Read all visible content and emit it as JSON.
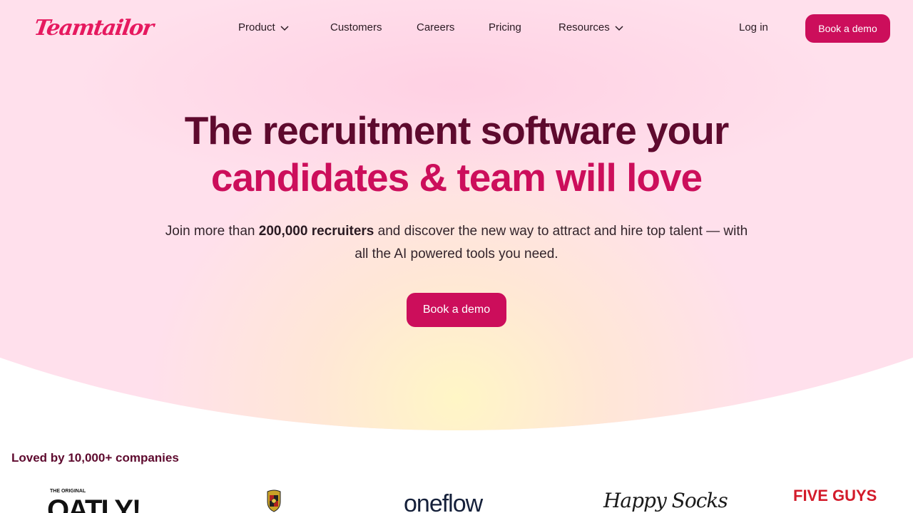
{
  "brand": {
    "name": "Teamtailor",
    "color": "#e6195f"
  },
  "nav": {
    "items": [
      {
        "label": "Product",
        "has_dropdown": true
      },
      {
        "label": "Customers",
        "has_dropdown": false
      },
      {
        "label": "Careers",
        "has_dropdown": false
      },
      {
        "label": "Pricing",
        "has_dropdown": false
      },
      {
        "label": "Resources",
        "has_dropdown": true
      }
    ],
    "login_label": "Log in",
    "cta_label": "Book a demo"
  },
  "hero": {
    "headline_line1": "The recruitment software your",
    "headline_line2": "candidates & team will love",
    "sub_before": "Join more than ",
    "sub_bold": "200,000 recruiters",
    "sub_after": " and discover the new way to attract and hire top talent — with all the AI powered tools you need.",
    "cta_label": "Book a demo"
  },
  "customers": {
    "heading": "Loved by 10,000+ companies",
    "logos": [
      {
        "name": "Oatly",
        "top": "THE ORIGINAL",
        "mark": "OATLY!"
      },
      {
        "name": "Porsche",
        "mark": ""
      },
      {
        "name": "Oneflow",
        "mark": "oneflow"
      },
      {
        "name": "Happy Socks",
        "mark": "Happy Socks"
      },
      {
        "name": "Five Guys",
        "mark": "FIVE GUYS"
      }
    ]
  },
  "colors": {
    "accent": "#cc0e5b",
    "headline_dark": "#5e0a2e",
    "hero_bg": "#ffe0ec"
  }
}
